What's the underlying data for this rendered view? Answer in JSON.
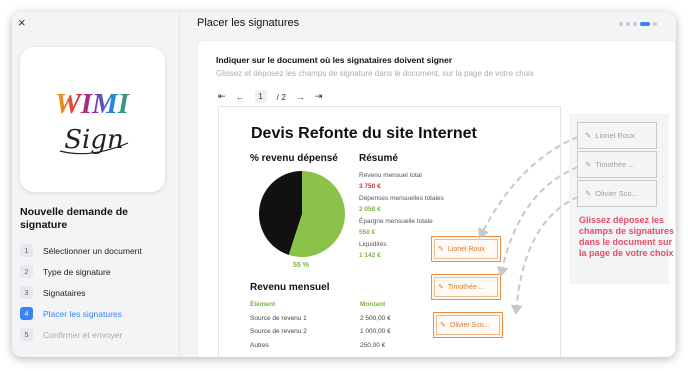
{
  "sidebar": {
    "close_label": "×",
    "logo": {
      "top_text": "WIMI",
      "bottom_text": "Sign"
    },
    "title": "Nouvelle demande de signature",
    "steps": [
      {
        "num": "1",
        "label": "Sélectionner un document"
      },
      {
        "num": "2",
        "label": "Type de signature"
      },
      {
        "num": "3",
        "label": "Signataires"
      },
      {
        "num": "4",
        "label": "Placer les signatures"
      },
      {
        "num": "5",
        "label": "Confirmer et envoyer"
      }
    ]
  },
  "main": {
    "title": "Placer les signatures",
    "card_title": "Indiquer sur le document où les signataires doivent signer",
    "card_subtitle": "Glissez et déposez les champs de signature dans le document, sur la page de votre choix",
    "pager": {
      "first": "⇤",
      "prev": "←",
      "page": "1",
      "total": "/ 2",
      "next": "→",
      "last": "⇥"
    },
    "signature_fields": [
      {
        "label": "Lionel Roux"
      },
      {
        "label": "Timothée ..."
      },
      {
        "label": "Olivier Sco..."
      }
    ],
    "hint": "Glissez déposez les champs de signatures dans le document sur la page de votre choix"
  },
  "document": {
    "title": "Devis Refonte du site Internet",
    "pie_heading": "% revenu dépensé",
    "pie_percent": "55 %",
    "summary_heading": "Résumé",
    "summary": [
      {
        "label": "Revenu mensuel total",
        "value": "3 750 €",
        "color": "#d32f2f"
      },
      {
        "label": "Dépenses mensuelles totales",
        "value": "2 058 €",
        "color": "#7cb342"
      },
      {
        "label": "Épargne mensuelle totale",
        "value": "550 €",
        "color": "#7cb342"
      },
      {
        "label": "Liquidités",
        "value": "1 142 €",
        "color": "#7cb342"
      }
    ],
    "table_heading": "Revenu mensuel",
    "table_headers": [
      "Élément",
      "Montant"
    ],
    "table_rows": [
      [
        "Source de revenu 1",
        "2 500,00 €"
      ],
      [
        "Source de revenu 2",
        "1 000,00 €"
      ],
      [
        "Autres",
        "250,00 €"
      ]
    ],
    "placed_fields": [
      {
        "label": "Lionel Roux"
      },
      {
        "label": "Timothée ..."
      },
      {
        "label": "Olivier Sco..."
      }
    ]
  },
  "chart_data": {
    "type": "pie",
    "categories": [
      "",
      ""
    ],
    "values": [
      55,
      45
    ],
    "colors": [
      "#8bc34a",
      "#111111"
    ],
    "title": "% revenu dépensé",
    "data_label": "55 %"
  },
  "colors": {
    "accent": "#3b82f6",
    "hint": "#e44d6a",
    "placed_border": "#ea8a3a",
    "negative": "#d32f2f",
    "positive": "#7cb342"
  }
}
